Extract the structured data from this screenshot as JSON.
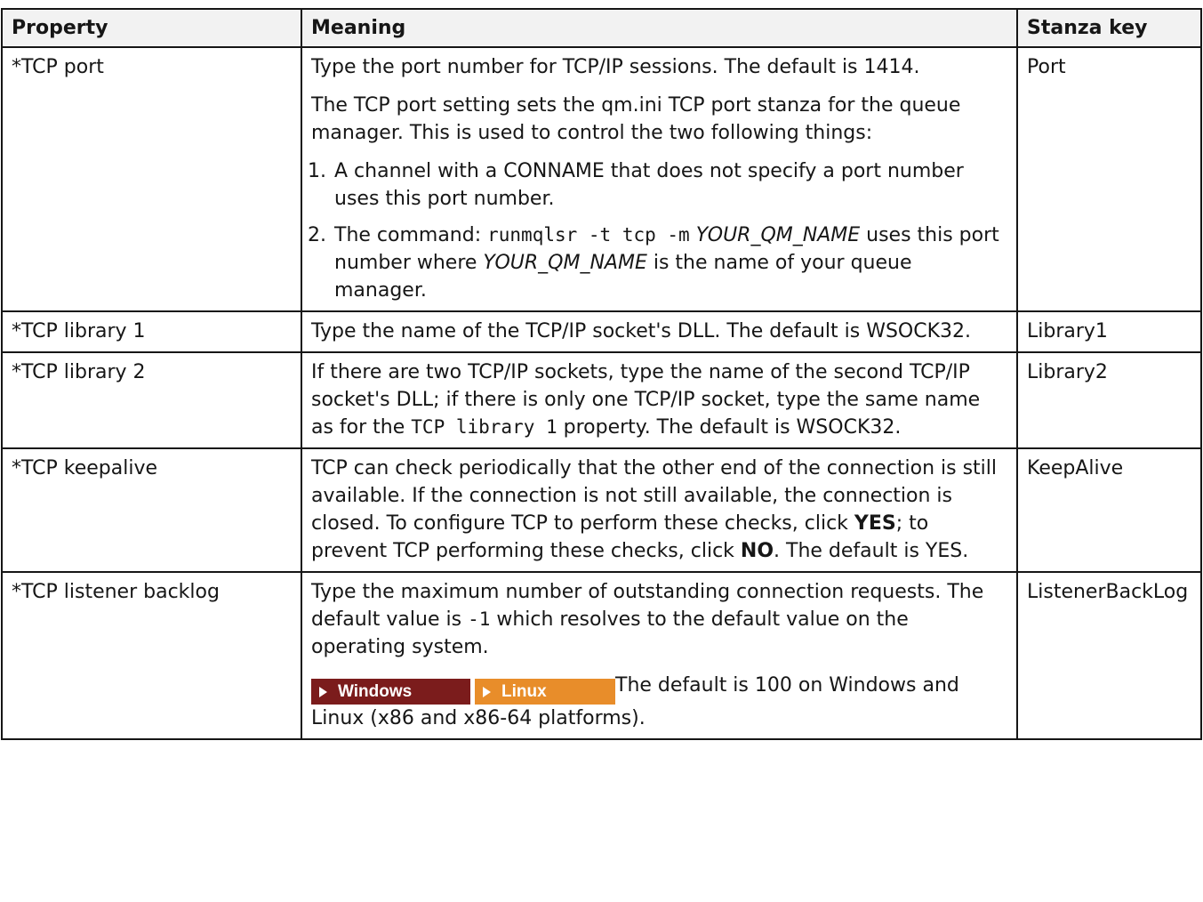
{
  "headers": {
    "property": "Property",
    "meaning": "Meaning",
    "stanza": "Stanza key"
  },
  "rows": {
    "port": {
      "property": "*TCP port",
      "p1": "Type the port number for TCP/IP sessions. The default is 1414.",
      "p2": "The TCP port setting sets the qm.ini TCP port stanza for the queue manager. This is used to control the two following things:",
      "li1": "A channel with a CONNAME that does not specify a port number uses this port number.",
      "li2_a": "The command: ",
      "li2_code": "runmqlsr -t tcp -m",
      "li2_var1": "YOUR_QM_NAME",
      "li2_b": " uses this port number where ",
      "li2_var2": "YOUR_QM_NAME",
      "li2_c": " is the name of your queue manager.",
      "stanza": "Port"
    },
    "lib1": {
      "property": "*TCP library 1",
      "p1": "Type the name of the TCP/IP socket's DLL. The default is WSOCK32.",
      "stanza": "Library1"
    },
    "lib2": {
      "property": "*TCP library 2",
      "p1_a": "If there are two TCP/IP sockets, type the name of the second TCP/IP socket's DLL; if there is only one TCP/IP socket, type the same name as for the ",
      "p1_code": "TCP library 1",
      "p1_b": " property. The default is WSOCK32.",
      "stanza": "Library2"
    },
    "keepalive": {
      "property": "*TCP keepalive",
      "p1_a": "TCP can check periodically that the other end of the connection is still available. If the connection is not still available, the connection is closed. To configure TCP to perform these checks, click ",
      "p1_yes": "YES",
      "p1_b": "; to prevent TCP performing these checks, click ",
      "p1_no": "NO",
      "p1_c": ". The default is YES.",
      "stanza": "KeepAlive"
    },
    "backlog": {
      "property": "*TCP listener backlog",
      "p1_a": "Type the maximum number of outstanding connection requests. The default value is ",
      "p1_code": "-1",
      "p1_b": " which resolves to the default value on the operating system.",
      "badge_windows": "Windows",
      "badge_linux": "Linux",
      "p2": "The default is 100 on Windows and Linux (x86 and x86-64 platforms).",
      "stanza": "ListenerBackLog"
    }
  },
  "colors": {
    "windows_badge": "#7b1c1c",
    "linux_badge": "#e88d2a",
    "header_bg": "#f2f2f2"
  }
}
